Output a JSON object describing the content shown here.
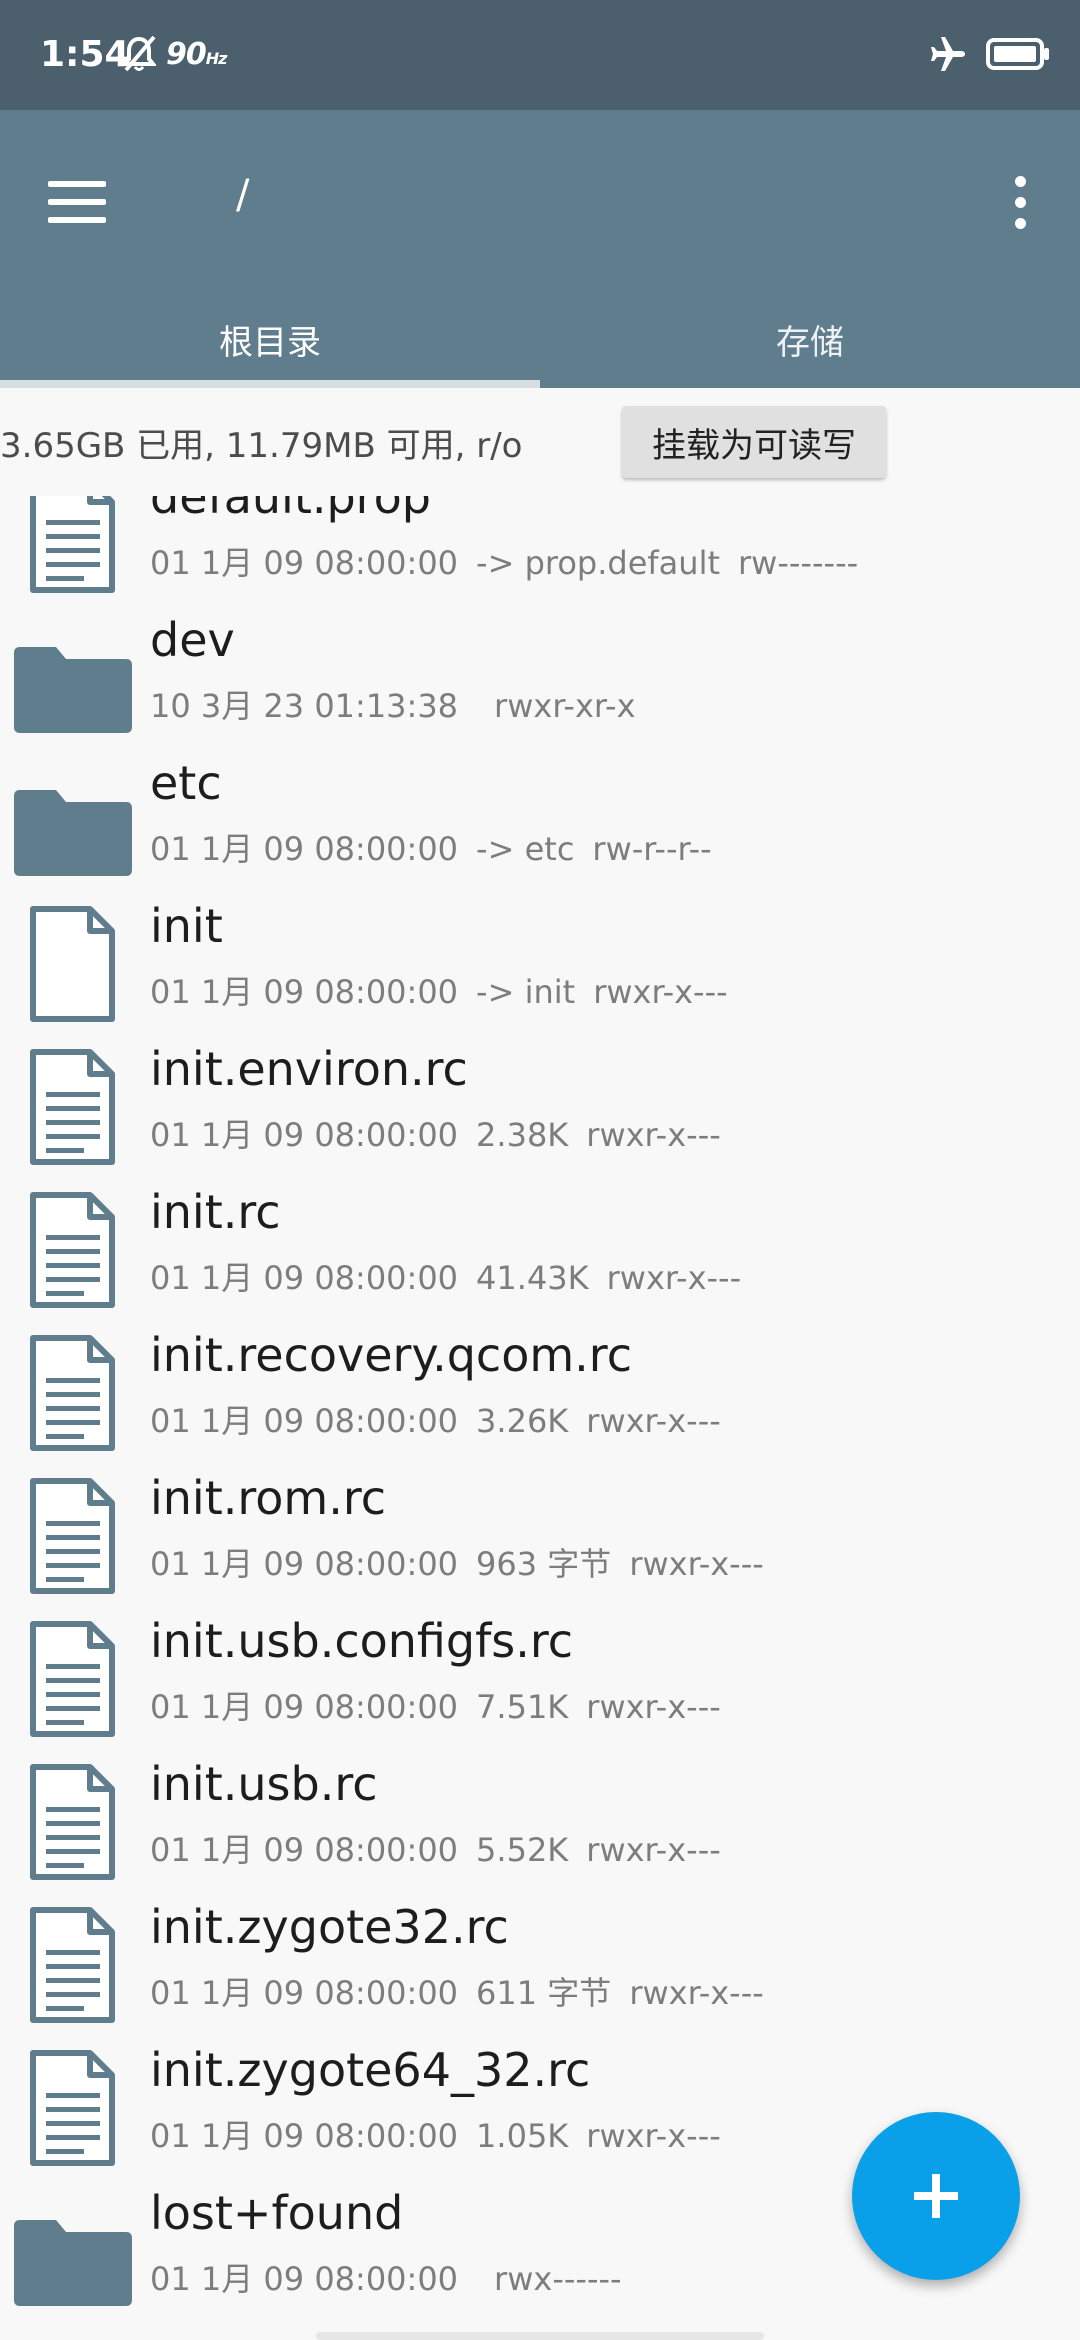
{
  "status": {
    "time": "1:54",
    "refresh_rate": "90",
    "refresh_unit": "Hz"
  },
  "app_bar": {
    "path": "/",
    "tabs": [
      {
        "label": "根目录",
        "active": true
      },
      {
        "label": "存储",
        "active": false
      }
    ]
  },
  "storage_info": {
    "text": "3.65GB 已用, 11.79MB 可用, r/o",
    "mount_button": "挂载为可读写"
  },
  "files": [
    {
      "name": "default.prop",
      "date": "01 1月 09 08:00:00",
      "detail": "-> prop.default",
      "perm": "rw-------",
      "icon": "text-file-icon"
    },
    {
      "name": "dev",
      "date": "10 3月 23 01:13:38",
      "detail": "",
      "perm": "rwxr-xr-x",
      "icon": "folder-icon"
    },
    {
      "name": "etc",
      "date": "01 1月 09 08:00:00",
      "detail": "-> etc",
      "perm": "rw-r--r--",
      "icon": "folder-icon"
    },
    {
      "name": "init",
      "date": "01 1月 09 08:00:00",
      "detail": "-> init",
      "perm": "rwxr-x---",
      "icon": "blank-file-icon"
    },
    {
      "name": "init.environ.rc",
      "date": "01 1月 09 08:00:00",
      "detail": "2.38K",
      "perm": "rwxr-x---",
      "icon": "text-file-icon"
    },
    {
      "name": "init.rc",
      "date": "01 1月 09 08:00:00",
      "detail": "41.43K",
      "perm": "rwxr-x---",
      "icon": "text-file-icon"
    },
    {
      "name": "init.recovery.qcom.rc",
      "date": "01 1月 09 08:00:00",
      "detail": "3.26K",
      "perm": "rwxr-x---",
      "icon": "text-file-icon"
    },
    {
      "name": "init.rom.rc",
      "date": "01 1月 09 08:00:00",
      "detail": "963 字节",
      "perm": "rwxr-x---",
      "icon": "text-file-icon"
    },
    {
      "name": "init.usb.configfs.rc",
      "date": "01 1月 09 08:00:00",
      "detail": "7.51K",
      "perm": "rwxr-x---",
      "icon": "text-file-icon"
    },
    {
      "name": "init.usb.rc",
      "date": "01 1月 09 08:00:00",
      "detail": "5.52K",
      "perm": "rwxr-x---",
      "icon": "text-file-icon"
    },
    {
      "name": "init.zygote32.rc",
      "date": "01 1月 09 08:00:00",
      "detail": "611 字节",
      "perm": "rwxr-x---",
      "icon": "text-file-icon"
    },
    {
      "name": "init.zygote64_32.rc",
      "date": "01 1月 09 08:00:00",
      "detail": "1.05K",
      "perm": "rwxr-x---",
      "icon": "text-file-icon"
    },
    {
      "name": "lost+found",
      "date": "01 1月 09 08:00:00",
      "detail": "",
      "perm": "rwx------",
      "icon": "folder-icon"
    }
  ],
  "colors": {
    "status_bar": "#4b5f6d",
    "app_bar": "#5f7d8c",
    "icon": "#5f7d8c",
    "fab": "#0aa0e9"
  }
}
